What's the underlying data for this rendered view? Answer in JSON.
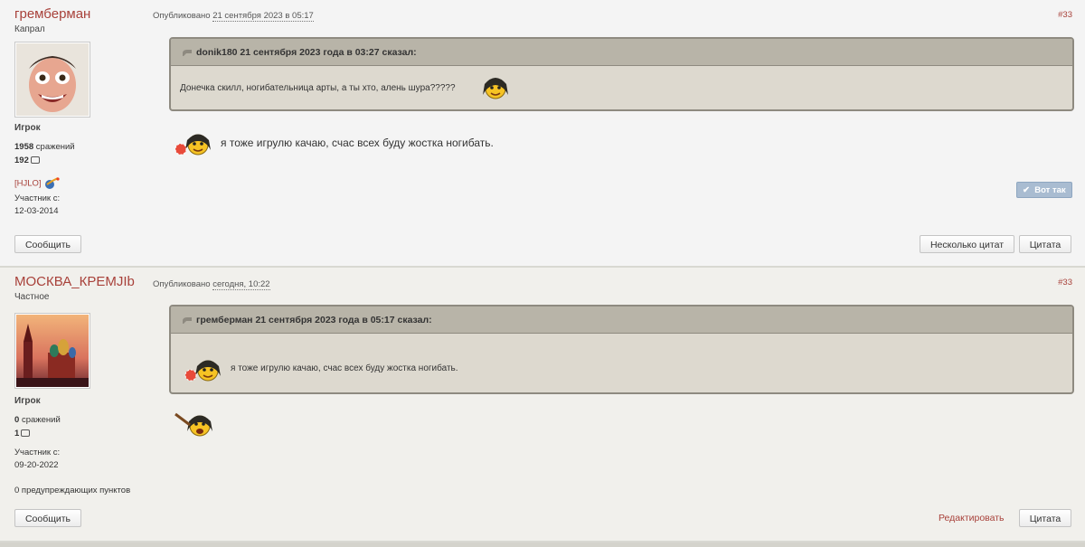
{
  "posts": [
    {
      "author": "гремберман",
      "rank": "Капрал",
      "group": "Игрок",
      "battles": "1958",
      "battles_label": "сражений",
      "comments": "192",
      "clan": "[HJLO]",
      "member_label": "Участник с:",
      "member_date": "12-03-2014",
      "published_label": "Опубликовано",
      "published_date": "21 сентября 2023 в 05:17",
      "number": "#33",
      "quote_header": "donik180 21 сентября 2023 года в 03:27 сказал:",
      "quote_text": "Донечка скилл, ногибательница арты, а ты хто, алень шура?????",
      "text": "я тоже игрулю качаю, счас всех буду жостка ногибать.",
      "like_label": "Вот так",
      "report_label": "Сообщить",
      "multiquote_label": "Несколько цитат",
      "quote_label": "Цитата"
    },
    {
      "author": "МОСКВА_КРЕМJIb",
      "rank": "Частное",
      "group": "Игрок",
      "battles": "0",
      "battles_label": "сражений",
      "comments": "1",
      "member_label": "Участник с:",
      "member_date": "09-20-2022",
      "warnings": "0 предупреждающих пунктов",
      "published_label": "Опубликовано",
      "published_date": "сегодня, 10:22",
      "number": "#33",
      "quote_header": "гремберман 21 сентября 2023 года в 05:17 сказал:",
      "quote_text": "я тоже игрулю качаю, счас всех буду жостка ногибать.",
      "report_label": "Сообщить",
      "edit_label": "Редактировать",
      "quote_label": "Цитата"
    }
  ],
  "icons": [
    "quote-icon",
    "comment-bubble-icon",
    "clan-emblem-icon",
    "smiley-icon",
    "checkmark-icon"
  ],
  "colors": {
    "author": "#a8413a",
    "quote_border": "#8e8a80",
    "quote_header_bg": "#b8b4a8",
    "quote_bg": "#ddd9cf",
    "like_btn": "#a9bcd1"
  }
}
